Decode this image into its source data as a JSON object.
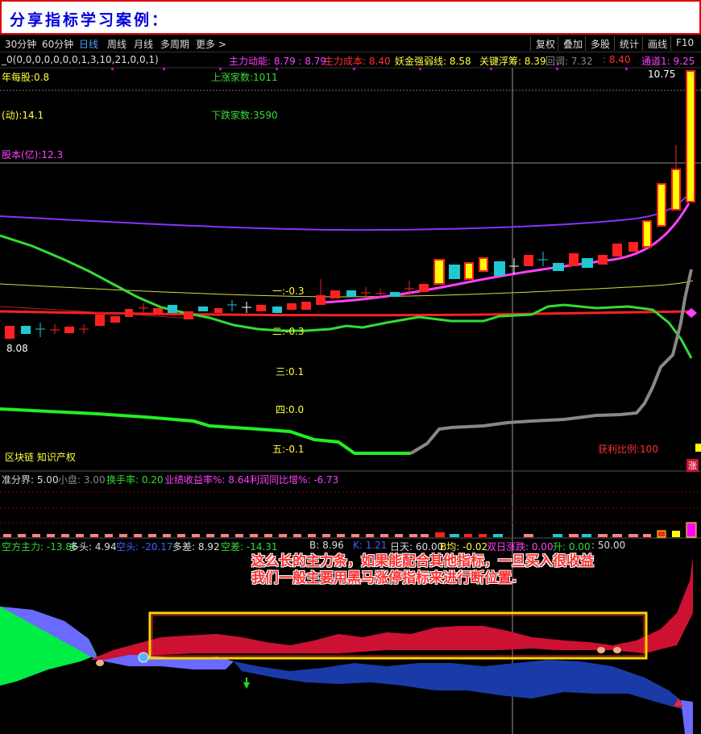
{
  "title": "分享指标学习案例：",
  "toolbar": {
    "left": [
      "30分钟",
      "60分钟",
      "日线",
      "周线",
      "月线",
      "多周期",
      "更多 >"
    ],
    "right": [
      "复权",
      "叠加",
      "多股",
      "统计",
      "画线",
      "F10"
    ]
  },
  "indicator_line": {
    "params": "_0(0,0,0,0,0,0,0,1,3,10,21,0,0,1)",
    "main_power_label": "主力动能: 8.79 : 8.79",
    "main_cost": "主力成本: 8.40",
    "demon_gold": "妖金强弱线: 8.58",
    "key_push": "关键浮筹: 8.39",
    "pullback": "回调: 7.32",
    "pullback2": ": 8.40",
    "channel": "通道1: 9.25"
  },
  "chart_labels": {
    "per_share": "年每股:0.8",
    "activity": "(动):14.1",
    "share_capital": "股本(亿):12.3",
    "up_count": "上涨家数:1011",
    "down_count": "下跌家数:3590",
    "high_price": "10.75",
    "low_price": "8.08",
    "level1": "一:-0.3",
    "level2": "二:-0.3",
    "level3": "三:0.1",
    "level4": "四:0.0",
    "level5": "五:-0.1",
    "concepts": "区块链 知识产权",
    "profit_ratio": "获利比例:100",
    "zhang": "涨"
  },
  "sub_header": {
    "std_line": "准分界: 5.00",
    "small_cap": "小盘: 3.00",
    "turnover": "换手率: 0.20",
    "perf_growth": "业绩收益率%: 8.64",
    "profit_yoy": "利润同比增%: -6.73"
  },
  "ind3": {
    "main_force": "空方主力: -13.86",
    "long_head": "多头: 4.94",
    "short_head": "空头: -20.17",
    "long_diff": "多差: 8.92",
    "short_diff": "空差: -14.31",
    "b": "B: 8.96",
    "k": "K: 1.21",
    "day": "日天: 60.00",
    "b_avg": "B均: -0.02",
    "double_limit": "双日涨跌: 0.00",
    "rise": "升: 0.00",
    "tail": ": 50.00"
  },
  "annotation": {
    "line1": "这么长的主力条，如果能配合其他指标，一旦买入很收益",
    "line2": "我们一般主要用黑马涨停指标来进行断位置."
  },
  "colors": {
    "title_text": "#0000dd",
    "title_border": "#e00000",
    "up_candle": "#ff2020",
    "down_candle": "#20c8d0",
    "highlight_box": "#ffd700"
  }
}
